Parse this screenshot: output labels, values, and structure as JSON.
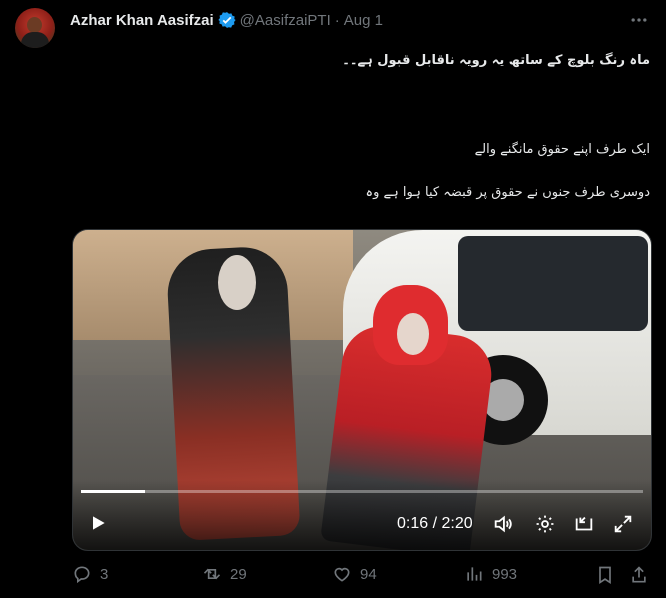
{
  "header": {
    "name": "Azhar Khan Aasifzai",
    "handle": "@AasifzaiPTI",
    "separator": "·",
    "date": "Aug 1"
  },
  "tweet": {
    "lines": [
      "ماہ رنگ بلوچ کے ساتھ یہ رویہ ناقابل قبول ہے۔۔",
      "ایک طرف اپنے حقوق مانگنے والے",
      "دوسری طرف جنوں نے حقوق پر قبضہ کیا ہوا ہے وہ"
    ]
  },
  "video": {
    "current_time": "0:16",
    "duration": "2:20",
    "time_text": "0:16 / 2:20",
    "progress_fraction": 0.114
  },
  "actions": {
    "reply_count": "3",
    "retweet_count": "29",
    "like_count": "94",
    "views_count": "993"
  },
  "colors": {
    "background": "#000000",
    "text": "#e7e9ea",
    "muted": "#71767b",
    "verified": "#1d9bf0"
  },
  "icons": {
    "verified": "verified-badge-icon",
    "more": "more-icon",
    "play": "play-icon",
    "volume": "volume-icon",
    "settings": "gear-icon",
    "pip": "picture-in-picture-icon",
    "fullscreen": "fullscreen-icon",
    "reply": "reply-icon",
    "retweet": "retweet-icon",
    "like": "heart-icon",
    "views": "views-icon",
    "bookmark": "bookmark-icon",
    "share": "share-icon"
  }
}
